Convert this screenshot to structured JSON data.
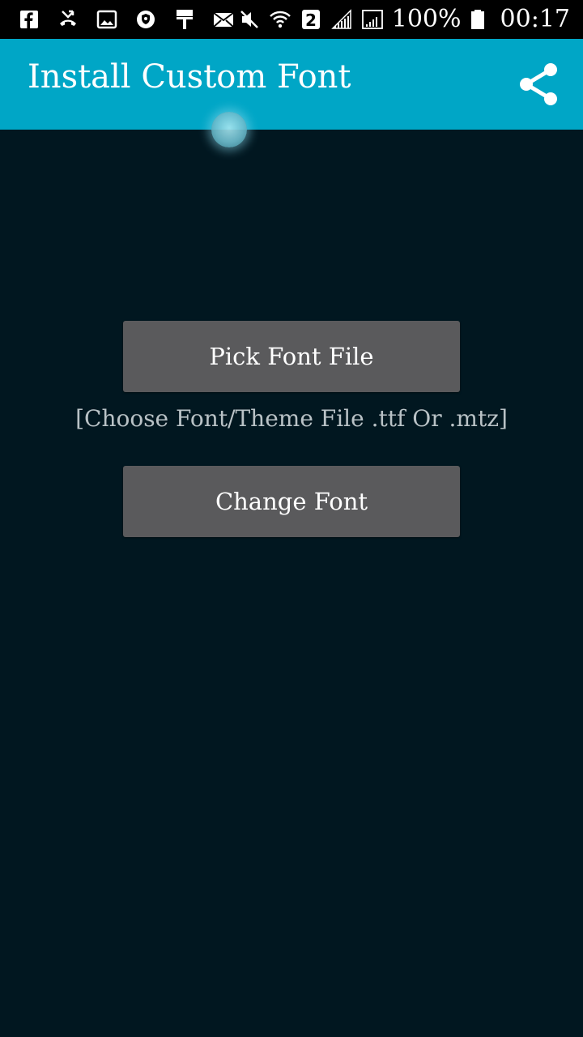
{
  "status_bar": {
    "left_icons": [
      "facebook-icon",
      "missed-call-icon",
      "image-icon",
      "shield-icon",
      "paint-roller-icon",
      "email-icon"
    ],
    "right_icons": [
      "mute-icon",
      "wifi-icon",
      "sim-2-icon",
      "signal-icon",
      "signal-icon",
      "battery-icon"
    ],
    "sim_label": "2",
    "battery_percent": "100%",
    "time": "00:17"
  },
  "app_bar": {
    "title": "Install Custom Font",
    "share_icon": "share-icon",
    "background_color": "#00a6c6"
  },
  "main": {
    "pick_button_label": "Pick Font File",
    "hint_text": "[Choose Font/Theme File .ttf Or .mtz]",
    "change_button_label": "Change Font",
    "background_color": "#011720",
    "button_color": "#5a5a5c"
  }
}
